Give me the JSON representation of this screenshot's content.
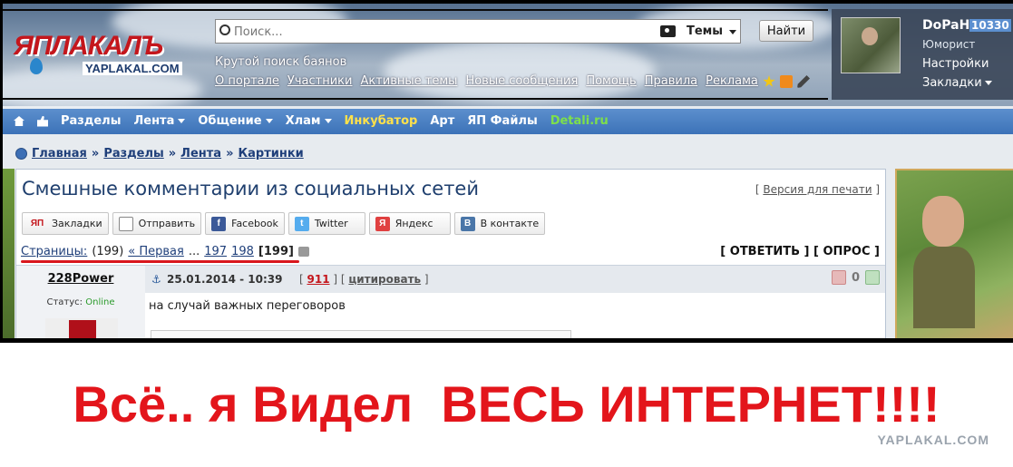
{
  "colors": {
    "accent": "#3c72b8",
    "brand": "#c4161c",
    "caption": "#e3151b",
    "online": "#2a9a2a"
  },
  "logo": {
    "main": "ЯПЛАКАЛЪ",
    "sub": "YAPLAKAL.COM"
  },
  "search": {
    "placeholder": "Поиск...",
    "scope": "Темы",
    "button": "Найти"
  },
  "tagline": "Крутой поиск баянов",
  "toplinks": [
    "О портале",
    "Участники",
    "Активные темы",
    "Новые сообщения",
    "Помощь",
    "Правила",
    "Реклама"
  ],
  "user": {
    "name": "DoPaH",
    "rep": "10330",
    "rank": "Юморист",
    "settings": "Настройки",
    "bookmarks": "Закладки"
  },
  "nav": [
    "Разделы",
    "Лента",
    "Общение",
    "Хлам",
    "Инкубатор",
    "Арт",
    "ЯП Файлы",
    "Detali.ru"
  ],
  "breadcrumb": [
    "Главная",
    "Разделы",
    "Лента",
    "Картинки"
  ],
  "topic": {
    "title": "Смешные комментарии из социальных сетей",
    "print_label": "Версия для печати",
    "share": [
      "Закладки",
      "Отправить",
      "Facebook",
      "Twitter",
      "Яндекс",
      "В контакте"
    ],
    "pages_label": "Страницы:",
    "pages_count": "(199)",
    "first": "« Первая",
    "ellipsis": "...",
    "p197": "197",
    "p198": "198",
    "current": "[199]",
    "reply": "[ ОТВЕТИТЬ ]",
    "poll": "[ ОПРОС ]"
  },
  "post": {
    "author": "228Power",
    "status_label": "Статус:",
    "status_value": "Online",
    "date": "25.01.2014 - 10:39",
    "number": "911",
    "quote_label": "цитировать",
    "rating": "0",
    "text": "на случай важных переговоров"
  },
  "caption": "Всё.. я Видел  ВЕСЬ ИНТЕРНЕТ!!!!",
  "watermark": "YAPLAKAL.COM"
}
